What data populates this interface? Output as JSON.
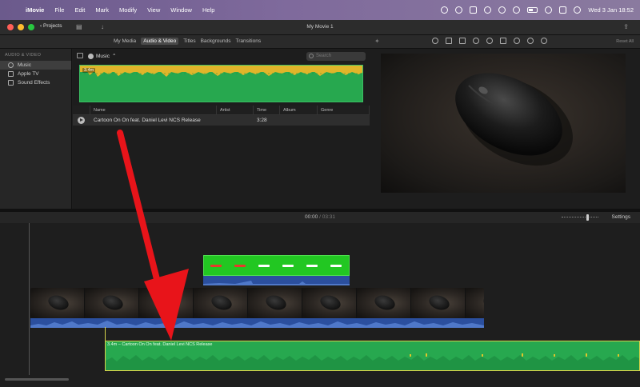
{
  "menubar": {
    "items": [
      "iMovie",
      "File",
      "Edit",
      "Mark",
      "Modify",
      "View",
      "Window",
      "Help"
    ],
    "clock": "Wed 3 Jan  18:52"
  },
  "window": {
    "projects_label": "Projects",
    "title": "My Movie 1"
  },
  "browser": {
    "tabs": [
      "My Media",
      "Audio & Video",
      "Titles",
      "Backgrounds",
      "Transitions"
    ],
    "active_tab": "Audio & Video",
    "source_dropdown": "Music",
    "search_placeholder": "Search",
    "preview_duration": "3.4m",
    "columns": [
      "Name",
      "Artist",
      "Time",
      "Album",
      "Genre"
    ],
    "rows": [
      {
        "name": "Cartoon On On feat. Daniel Levi NCS Release",
        "artist": "",
        "time": "3:28",
        "album": "",
        "genre": ""
      }
    ]
  },
  "sidebar": {
    "header": "AUDIO & VIDEO",
    "items": [
      {
        "label": "Music",
        "selected": true
      },
      {
        "label": "Apple TV",
        "selected": false
      },
      {
        "label": "Sound Effects",
        "selected": false
      }
    ]
  },
  "viewer": {
    "reset_all": "Reset All"
  },
  "timeline": {
    "current_time": "00:00",
    "separator": "/",
    "total_time": "03:31",
    "settings_label": "Settings",
    "music_clip_label": "3.4m – Cartoon On On feat. Daniel Levi NCS Release"
  },
  "colors": {
    "music_clip": "#27a84f",
    "title_clip": "#22c722",
    "audio_blue": "#2b4f9e",
    "annotation_arrow": "#e8141a"
  }
}
